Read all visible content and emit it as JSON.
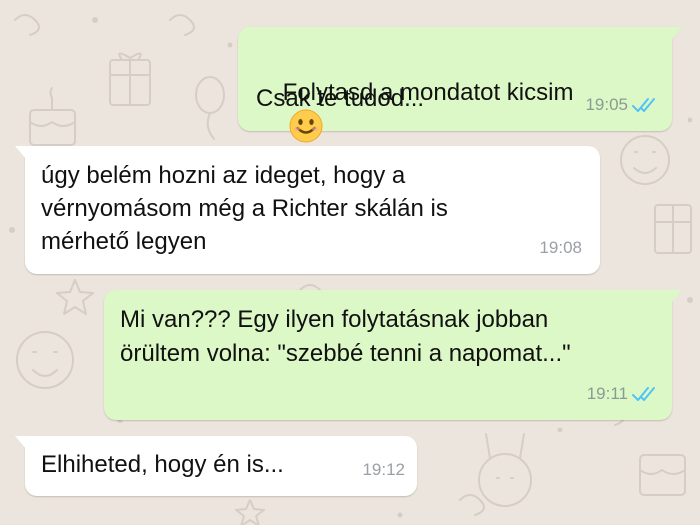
{
  "colors": {
    "outgoing_bubble": "#dcf8c6",
    "incoming_bubble": "#ffffff",
    "background": "#ece5dd",
    "read_ticks": "#4fc3f7"
  },
  "messages": [
    {
      "direction": "outgoing",
      "lines": [
        "Folytasd a mondatot kicsim",
        "Csak te tudod..."
      ],
      "emoji": "smiling-face-icon",
      "time": "19:05",
      "status": "read"
    },
    {
      "direction": "incoming",
      "lines": [
        "úgy belém hozni az ideget, hogy a",
        "vérnyomásom még a Richter skálán is",
        "mérhető legyen"
      ],
      "time": "19:08"
    },
    {
      "direction": "outgoing",
      "lines": [
        "Mi van??? Egy ilyen folytatásnak jobban",
        "örültem volna: \"szebbé tenni a napomat...\""
      ],
      "time": "19:11",
      "status": "read"
    },
    {
      "direction": "incoming",
      "lines": [
        "Elhiheted, hogy én is..."
      ],
      "time": "19:12"
    }
  ]
}
